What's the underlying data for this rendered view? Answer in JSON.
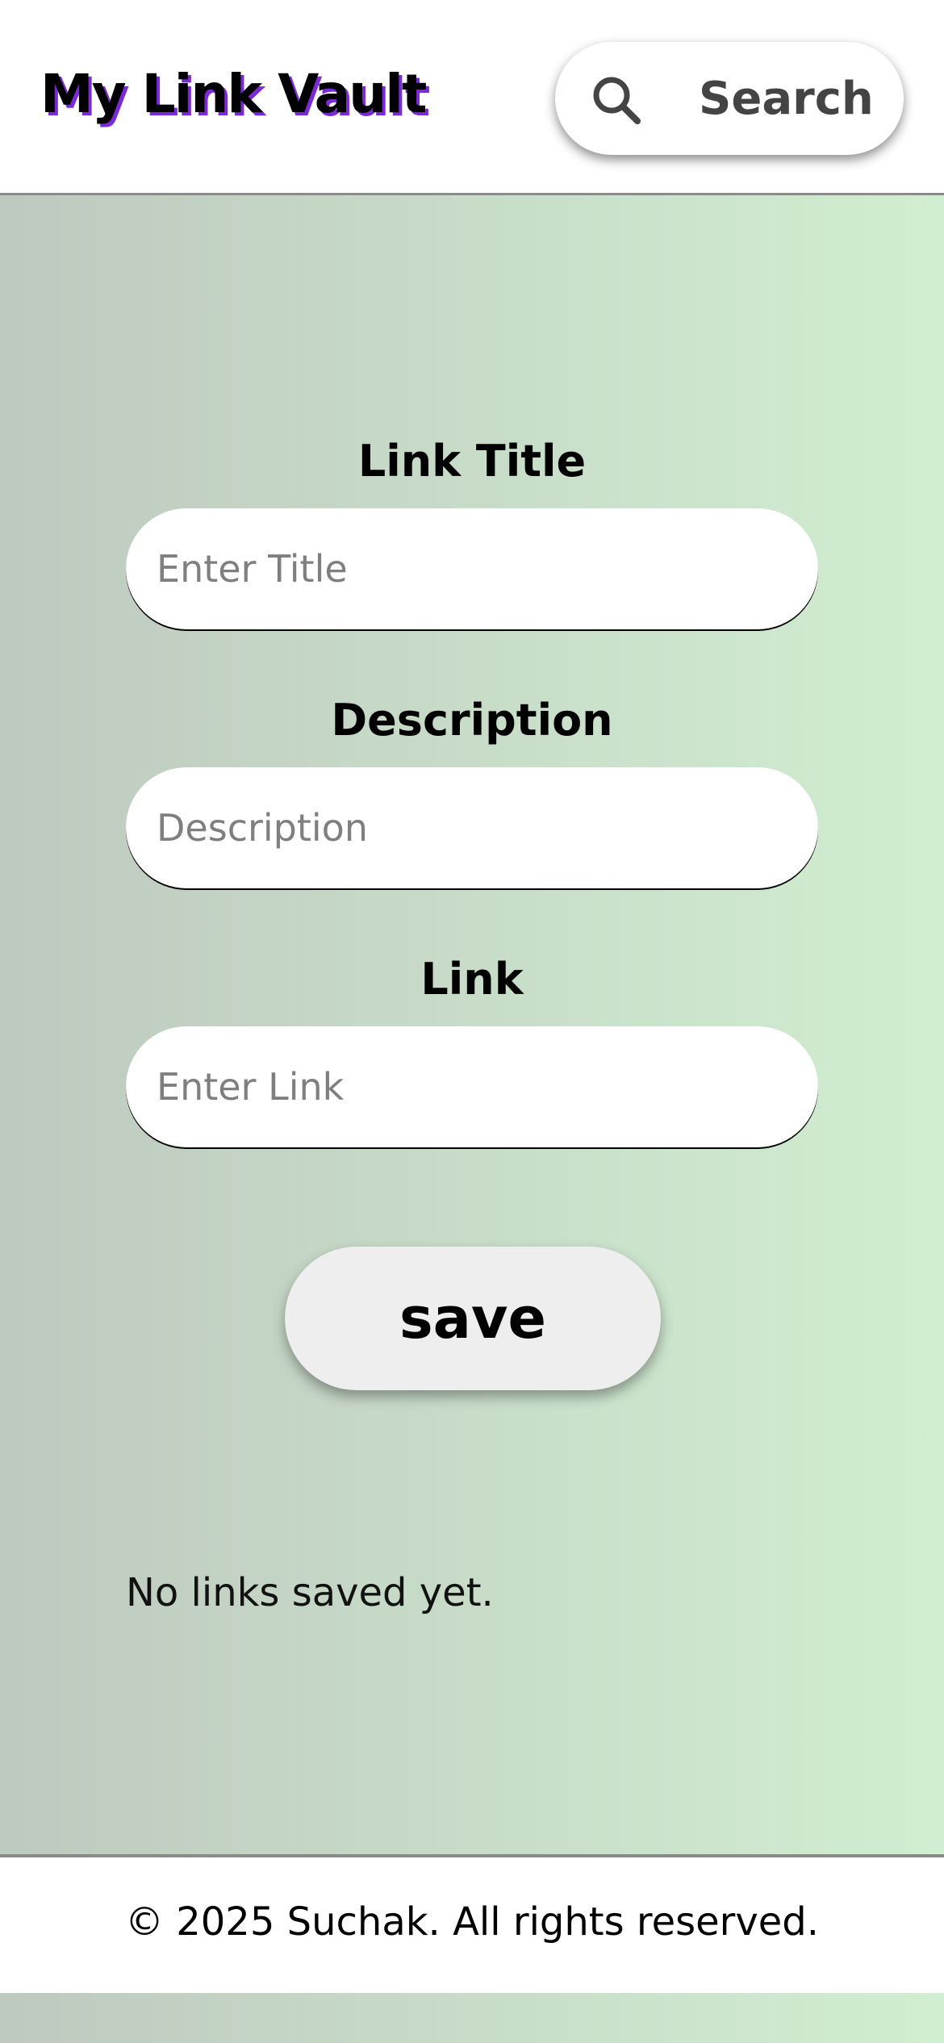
{
  "header": {
    "app_title": "My Link Vault",
    "search_label": "Search",
    "search_icon": "search-icon"
  },
  "form": {
    "title_label": "Link Title",
    "title_placeholder": "Enter Title",
    "title_value": "",
    "description_label": "Description",
    "description_placeholder": "Description",
    "description_value": "",
    "link_label": "Link",
    "link_placeholder": "Enter Link",
    "link_value": "",
    "save_label": "save"
  },
  "links": {
    "empty_message": "No links saved yet."
  },
  "footer": {
    "copyright": "© 2025 Suchak. All rights reserved."
  },
  "colors": {
    "title_shadow": "#7a2bd6",
    "gradient_start": "#bec9bf",
    "gradient_end": "#d0eed1",
    "button_bg": "#eeeeee",
    "placeholder": "#7f7f7f"
  }
}
